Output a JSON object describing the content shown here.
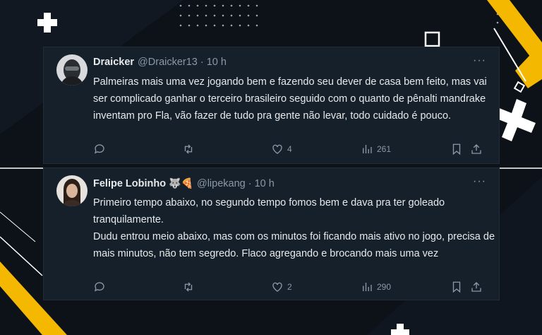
{
  "tweets": [
    {
      "name": "Draicker",
      "emojis": "",
      "handle": "@Draicker13",
      "dot": "·",
      "time": "10 h",
      "more": "···",
      "text": [
        "Palmeiras mais uma vez jogando bem e fazendo seu dever de casa bem feito, mas vai ser complicado ganhar o terceiro brasileiro seguido com o quanto de pênalti mandrake inventam pro Fla, vão fazer de tudo pra gente não levar, todo cuidado é pouco."
      ],
      "likes": "4",
      "views": "261"
    },
    {
      "name": "Felipe Lobinho",
      "emojis": "🐺🍕",
      "handle": "@lipekang",
      "dot": "·",
      "time": "10 h",
      "more": "···",
      "text": [
        "Primeiro tempo abaixo, no segundo tempo fomos bem e dava pra ter goleado tranquilamente.",
        "Dudu entrou meio abaixo, mas com os minutos foi ficando mais ativo no jogo, precisa de mais minutos, não tem segredo. Flaco agregando e brocando mais uma vez"
      ],
      "likes": "2",
      "views": "290"
    }
  ]
}
